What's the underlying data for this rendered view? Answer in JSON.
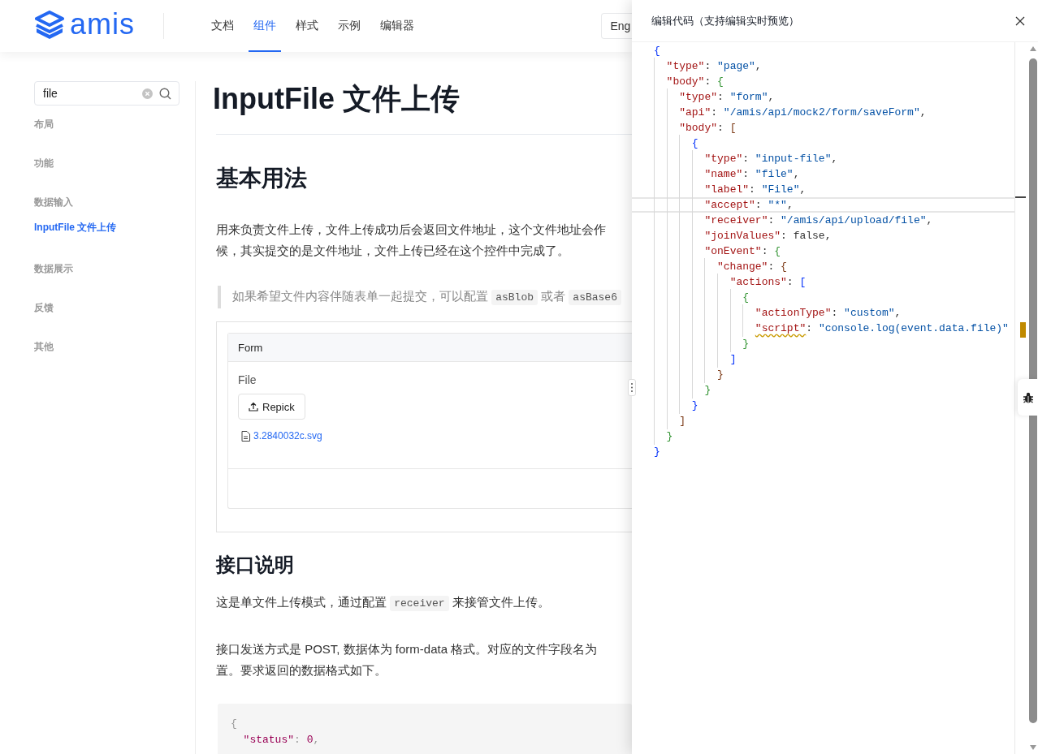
{
  "header": {
    "logo_text": "amis",
    "nav": [
      {
        "label": "文档",
        "selected": false
      },
      {
        "label": "组件",
        "selected": true
      },
      {
        "label": "样式",
        "selected": false
      },
      {
        "label": "示例",
        "selected": false
      },
      {
        "label": "编辑器",
        "selected": false
      }
    ],
    "language_button": "Eng"
  },
  "sidebar": {
    "search": {
      "value": "file"
    },
    "items": [
      {
        "kind": "section",
        "label": "布局",
        "selected": false
      },
      {
        "kind": "section",
        "label": "功能",
        "selected": false
      },
      {
        "kind": "section",
        "label": "数据输入",
        "selected": false
      },
      {
        "kind": "link",
        "label": "InputFile 文件上传",
        "selected": true
      },
      {
        "kind": "section",
        "label": "数据展示",
        "selected": false
      },
      {
        "kind": "section",
        "label": "反馈",
        "selected": false
      },
      {
        "kind": "section",
        "label": "其他",
        "selected": false
      }
    ]
  },
  "article": {
    "title": "InputFile 文件上传",
    "sections": [
      {
        "heading": "基本用法",
        "blocks": [
          {
            "kind": "paragraph",
            "lines": [
              [
                {
                  "text": "用来负责文件上传，文件上传成功后会返回文件地址，这个文件地址会作",
                  "kind": "text"
                }
              ],
              [
                {
                  "text": "候，其实提交的是文件地址，文件上传已经在这个控件中完成了。",
                  "kind": "text"
                }
              ]
            ]
          },
          {
            "kind": "quote",
            "lines": [
              [
                {
                  "text": "如果希望文件内容伴随表单一起提交，可以配置 ",
                  "kind": "text"
                },
                {
                  "text": "asBlob",
                  "kind": "code"
                },
                {
                  "text": " 或者 ",
                  "kind": "text"
                },
                {
                  "text": "asBase6",
                  "kind": "code"
                }
              ]
            ]
          },
          {
            "kind": "example",
            "form": {
              "title": "Form",
              "field_label": "File",
              "button": "Repick",
              "file_name": "3.2840032c.svg"
            }
          }
        ]
      },
      {
        "heading": "接口说明",
        "blocks": [
          {
            "kind": "paragraph",
            "lines": [
              [
                {
                  "text": "这是单文件上传模式，通过配置 ",
                  "kind": "text"
                },
                {
                  "text": "receiver",
                  "kind": "code"
                },
                {
                  "text": " 来接管文件上传。",
                  "kind": "text"
                }
              ]
            ]
          },
          {
            "kind": "paragraph",
            "lines": [
              [
                {
                  "text": "接口发送方式是 POST, 数据体为 form-data 格式。对应的文件字段名为",
                  "kind": "text"
                }
              ],
              [
                {
                  "text": "置。要求返回的数据格式如下。",
                  "kind": "text"
                }
              ]
            ]
          },
          {
            "kind": "code",
            "lines": [
              "{",
              "  \"status\": 0,"
            ]
          }
        ]
      }
    ]
  },
  "drawer": {
    "title": "编辑代码（支持编辑实时预览）",
    "editor_lines": [
      {
        "text": "{",
        "current": false,
        "warning": false
      },
      {
        "text": "  \"type\": \"page\",",
        "current": false,
        "warning": false
      },
      {
        "text": "  \"body\": {",
        "current": false,
        "warning": false
      },
      {
        "text": "    \"type\": \"form\",",
        "current": false,
        "warning": false
      },
      {
        "text": "    \"api\": \"/amis/api/mock2/form/saveForm\",",
        "current": false,
        "warning": false
      },
      {
        "text": "    \"body\": [",
        "current": false,
        "warning": false
      },
      {
        "text": "      {",
        "current": false,
        "warning": false
      },
      {
        "text": "        \"type\": \"input-file\",",
        "current": false,
        "warning": false
      },
      {
        "text": "        \"name\": \"file\",",
        "current": false,
        "warning": false
      },
      {
        "text": "        \"label\": \"File\",",
        "current": false,
        "warning": false
      },
      {
        "text": "        \"accept\": \"*\",",
        "current": true,
        "warning": false
      },
      {
        "text": "        \"receiver\": \"/amis/api/upload/file\",",
        "current": false,
        "warning": false
      },
      {
        "text": "        \"joinValues\": false,",
        "current": false,
        "warning": false
      },
      {
        "text": "        \"onEvent\": {",
        "current": false,
        "warning": false
      },
      {
        "text": "          \"change\": {",
        "current": false,
        "warning": false
      },
      {
        "text": "            \"actions\": [",
        "current": false,
        "warning": false
      },
      {
        "text": "              {",
        "current": false,
        "warning": false
      },
      {
        "text": "                \"actionType\": \"custom\",",
        "current": false,
        "warning": false
      },
      {
        "text": "                \"script\": \"console.log(event.data.file)\"",
        "current": false,
        "warning": true
      },
      {
        "text": "              }",
        "current": false,
        "warning": false
      },
      {
        "text": "            ]",
        "current": false,
        "warning": false
      },
      {
        "text": "          }",
        "current": false,
        "warning": false
      },
      {
        "text": "        }",
        "current": false,
        "warning": false
      },
      {
        "text": "      }",
        "current": false,
        "warning": false
      },
      {
        "text": "    ]",
        "current": false,
        "warning": false
      },
      {
        "text": "  }",
        "current": false,
        "warning": false
      },
      {
        "text": "}",
        "current": false,
        "warning": false
      }
    ]
  }
}
